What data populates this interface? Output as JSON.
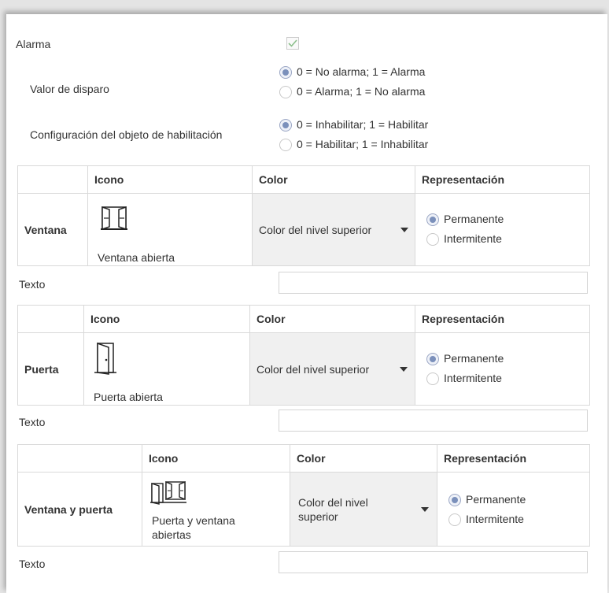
{
  "alarm": {
    "label": "Alarma",
    "checked": true
  },
  "trigger": {
    "label": "Valor de disparo",
    "options": [
      "0 = No alarma; 1 = Alarma",
      "0 = Alarma; 1 = No alarma"
    ],
    "selected": 0
  },
  "enable_config": {
    "label": "Configuración del objeto de habilitación",
    "options": [
      "0 = Inhabilitar; 1 = Habilitar",
      "0 = Habilitar; 1 = Inhabilitar"
    ],
    "selected": 0
  },
  "columns": {
    "icon": "Icono",
    "color": "Color",
    "representation": "Representación"
  },
  "representation_options": [
    "Permanente",
    "Intermitente"
  ],
  "text_label": "Texto",
  "sections": [
    {
      "name": "Ventana",
      "icon": "open-window-icon",
      "icon_caption": "Ventana abierta",
      "color": "Color del nivel superior",
      "selected": 0,
      "text_value": ""
    },
    {
      "name": "Puerta",
      "icon": "open-door-icon",
      "icon_caption": "Puerta abierta",
      "color": "Color del nivel superior",
      "selected": 0,
      "text_value": ""
    },
    {
      "name": "Ventana y puerta",
      "icon": "door-and-window-icon",
      "icon_caption": "Puerta y ventana abiertas",
      "color": "Color del nivel superior",
      "selected": 0,
      "text_value": ""
    }
  ],
  "colors": {
    "radio_selected": "#7b90bb",
    "border": "#d9d9d9",
    "checkmark": "#8cbf8c"
  }
}
